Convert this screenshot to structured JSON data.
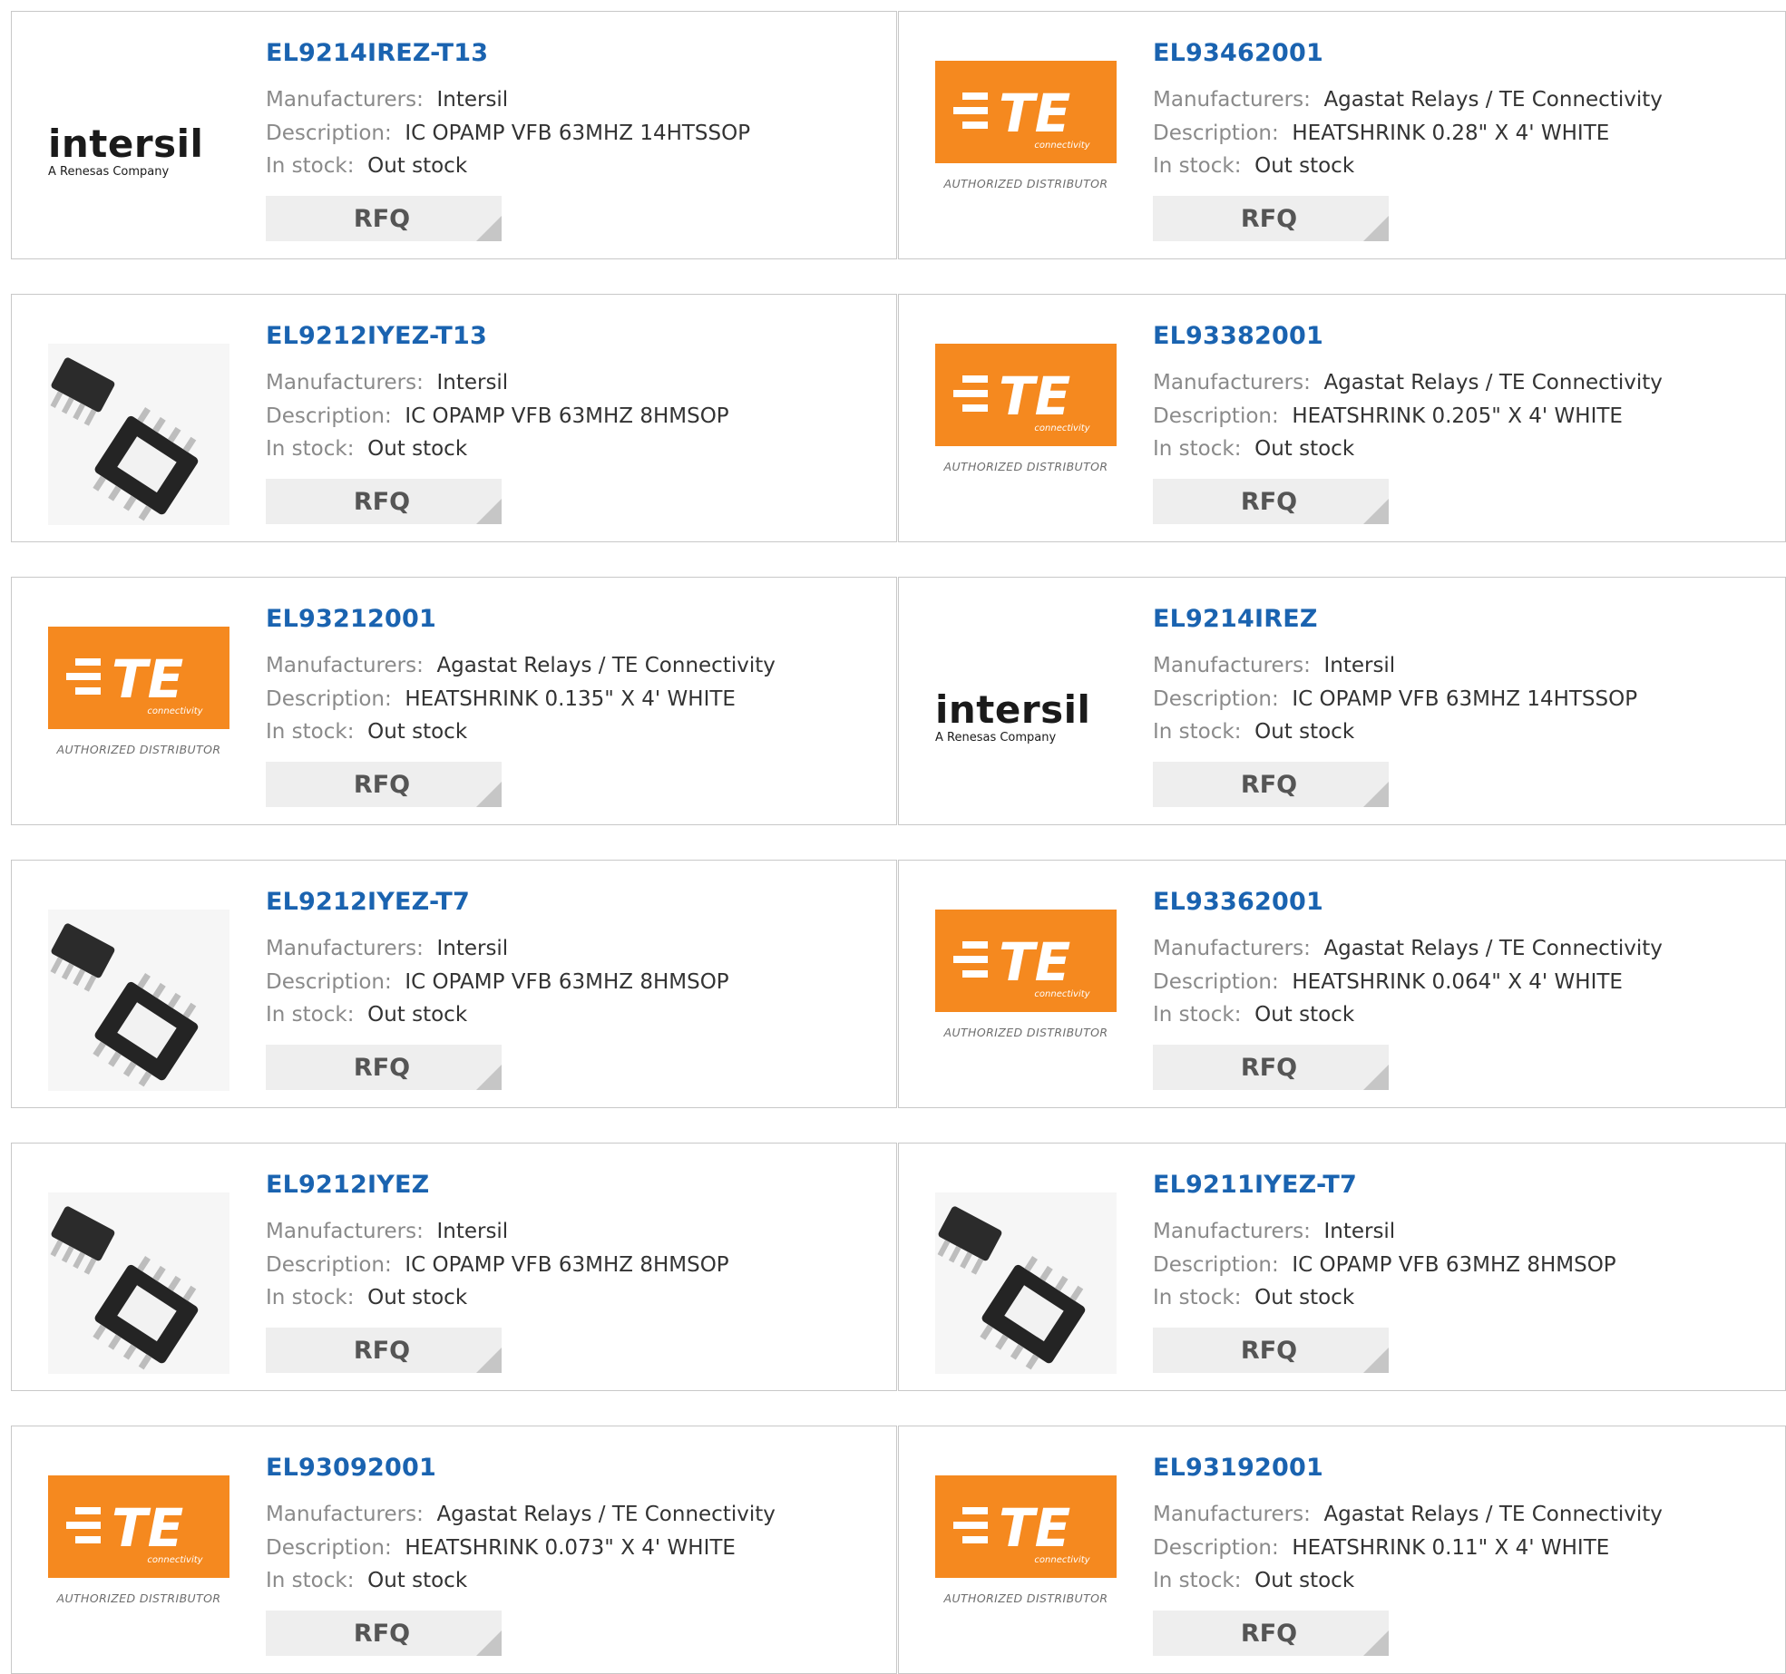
{
  "labels": {
    "manufacturers": "Manufacturers:",
    "description": "Description:",
    "in_stock": "In stock:",
    "rfq": "RFQ"
  },
  "colors": {
    "link": "#1a63b0",
    "te_orange": "#f5891f",
    "rfq_bg": "#eeeeee",
    "border": "#c8c8c8"
  },
  "logos": {
    "intersil": {
      "word": "intersil",
      "sub": "A Renesas Company"
    },
    "te": {
      "mark": "TE",
      "sub": "connectivity",
      "tag": "AUTHORIZED DISTRIBUTOR"
    }
  },
  "products": [
    {
      "part": "EL9214IREZ-T13",
      "manufacturer": "Intersil",
      "description": "IC OPAMP VFB 63MHZ 14HTSSOP",
      "stock": "Out stock",
      "logo": "intersil"
    },
    {
      "part": "EL93462001",
      "manufacturer": "Agastat Relays / TE Connectivity",
      "description": "HEATSHRINK 0.28\" X 4' WHITE",
      "stock": "Out stock",
      "logo": "te"
    },
    {
      "part": "EL9212IYEZ-T13",
      "manufacturer": "Intersil",
      "description": "IC OPAMP VFB 63MHZ 8HMSOP",
      "stock": "Out stock",
      "logo": "chip"
    },
    {
      "part": "EL93382001",
      "manufacturer": "Agastat Relays / TE Connectivity",
      "description": "HEATSHRINK 0.205\" X 4' WHITE",
      "stock": "Out stock",
      "logo": "te"
    },
    {
      "part": "EL93212001",
      "manufacturer": "Agastat Relays / TE Connectivity",
      "description": "HEATSHRINK 0.135\" X 4' WHITE",
      "stock": "Out stock",
      "logo": "te"
    },
    {
      "part": "EL9214IREZ",
      "manufacturer": "Intersil",
      "description": "IC OPAMP VFB 63MHZ 14HTSSOP",
      "stock": "Out stock",
      "logo": "intersil"
    },
    {
      "part": "EL9212IYEZ-T7",
      "manufacturer": "Intersil",
      "description": "IC OPAMP VFB 63MHZ 8HMSOP",
      "stock": "Out stock",
      "logo": "chip"
    },
    {
      "part": "EL93362001",
      "manufacturer": "Agastat Relays / TE Connectivity",
      "description": "HEATSHRINK 0.064\" X 4' WHITE",
      "stock": "Out stock",
      "logo": "te"
    },
    {
      "part": "EL9212IYEZ",
      "manufacturer": "Intersil",
      "description": "IC OPAMP VFB 63MHZ 8HMSOP",
      "stock": "Out stock",
      "logo": "chip"
    },
    {
      "part": "EL9211IYEZ-T7",
      "manufacturer": "Intersil",
      "description": "IC OPAMP VFB 63MHZ 8HMSOP",
      "stock": "Out stock",
      "logo": "chip"
    },
    {
      "part": "EL93092001",
      "manufacturer": "Agastat Relays / TE Connectivity",
      "description": "HEATSHRINK 0.073\" X 4' WHITE",
      "stock": "Out stock",
      "logo": "te"
    },
    {
      "part": "EL93192001",
      "manufacturer": "Agastat Relays / TE Connectivity",
      "description": "HEATSHRINK 0.11\" X 4' WHITE",
      "stock": "Out stock",
      "logo": "te"
    }
  ]
}
